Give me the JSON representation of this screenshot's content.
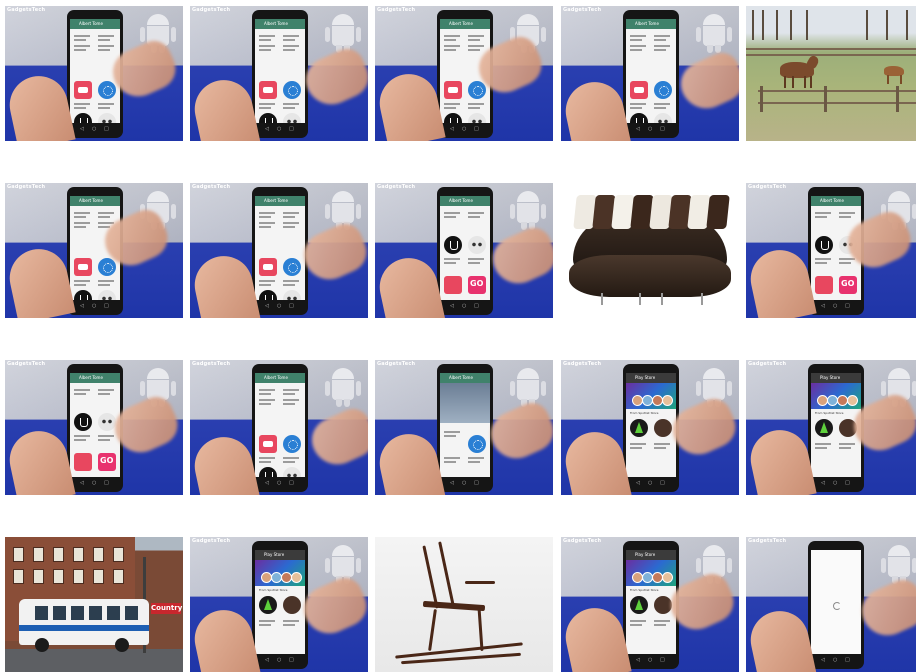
{
  "watermark": "GadgetsTech",
  "app_title": "Albert Tome",
  "store_title": "Play Store",
  "store_section": "From Spotlist Store",
  "sign_text": "Country",
  "colors": {
    "wall_blue": "#1f35a8",
    "appbar_green": "#40826b",
    "go_pink": "#e8326e"
  },
  "tiles": [
    {
      "kind": "phone-apps",
      "variant": "a"
    },
    {
      "kind": "phone-apps",
      "variant": "a"
    },
    {
      "kind": "phone-apps",
      "variant": "a"
    },
    {
      "kind": "phone-apps",
      "variant": "a"
    },
    {
      "kind": "horses"
    },
    {
      "kind": "phone-apps",
      "variant": "a"
    },
    {
      "kind": "phone-apps",
      "variant": "a"
    },
    {
      "kind": "phone-apps",
      "variant": "b"
    },
    {
      "kind": "sofa"
    },
    {
      "kind": "phone-apps",
      "variant": "b"
    },
    {
      "kind": "phone-apps",
      "variant": "b"
    },
    {
      "kind": "phone-apps",
      "variant": "a"
    },
    {
      "kind": "phone-apps",
      "variant": "c"
    },
    {
      "kind": "phone-store"
    },
    {
      "kind": "phone-store"
    },
    {
      "kind": "bus"
    },
    {
      "kind": "phone-store"
    },
    {
      "kind": "chair"
    },
    {
      "kind": "phone-store"
    },
    {
      "kind": "phone-loading"
    }
  ]
}
